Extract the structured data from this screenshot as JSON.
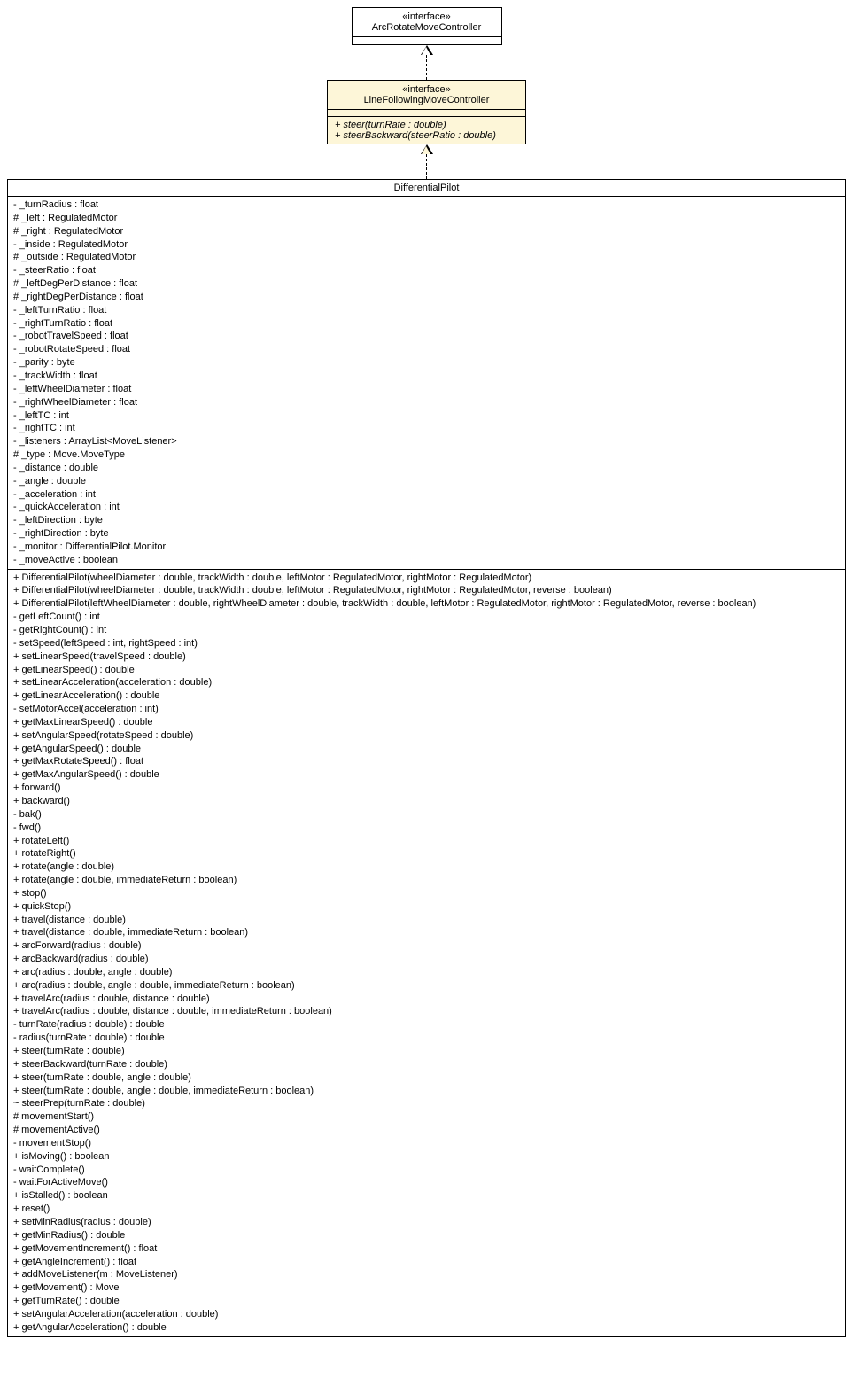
{
  "interface1": {
    "stereotype": "«interface»",
    "name": "ArcRotateMoveController"
  },
  "interface2": {
    "stereotype": "«interface»",
    "name": "LineFollowingMoveController",
    "ops": [
      "+ steer(turnRate : double)",
      "+ steerBackward(steerRatio : double)"
    ]
  },
  "class1": {
    "name": "DifferentialPilot",
    "attrs": [
      "- _turnRadius : float",
      "# _left : RegulatedMotor",
      "# _right : RegulatedMotor",
      "- _inside : RegulatedMotor",
      "# _outside : RegulatedMotor",
      "- _steerRatio : float",
      "# _leftDegPerDistance : float",
      "# _rightDegPerDistance : float",
      "- _leftTurnRatio : float",
      "- _rightTurnRatio : float",
      "- _robotTravelSpeed : float",
      "- _robotRotateSpeed : float",
      "- _parity : byte",
      "- _trackWidth : float",
      "- _leftWheelDiameter : float",
      "- _rightWheelDiameter : float",
      "- _leftTC : int",
      "- _rightTC : int",
      "- _listeners : ArrayList<MoveListener>",
      "# _type : Move.MoveType",
      "- _distance : double",
      "- _angle : double",
      "- _acceleration : int",
      "- _quickAcceleration : int",
      "- _leftDirection : byte",
      "- _rightDirection : byte",
      "- _monitor : DifferentialPilot.Monitor",
      "- _moveActive : boolean"
    ],
    "ops": [
      "+ DifferentialPilot(wheelDiameter : double, trackWidth : double, leftMotor : RegulatedMotor, rightMotor : RegulatedMotor)",
      "+ DifferentialPilot(wheelDiameter : double, trackWidth : double, leftMotor : RegulatedMotor, rightMotor : RegulatedMotor, reverse : boolean)",
      "+ DifferentialPilot(leftWheelDiameter : double, rightWheelDiameter : double, trackWidth : double, leftMotor : RegulatedMotor, rightMotor : RegulatedMotor, reverse : boolean)",
      "- getLeftCount() : int",
      "- getRightCount() : int",
      "- setSpeed(leftSpeed : int, rightSpeed : int)",
      "+ setLinearSpeed(travelSpeed : double)",
      "+ getLinearSpeed() : double",
      "+ setLinearAcceleration(acceleration : double)",
      "+ getLinearAcceleration() : double",
      "- setMotorAccel(acceleration : int)",
      "+ getMaxLinearSpeed() : double",
      "+ setAngularSpeed(rotateSpeed : double)",
      "+ getAngularSpeed() : double",
      "+ getMaxRotateSpeed() : float",
      "+ getMaxAngularSpeed() : double",
      "+ forward()",
      "+ backward()",
      "- bak()",
      "- fwd()",
      "+ rotateLeft()",
      "+ rotateRight()",
      "+ rotate(angle : double)",
      "+ rotate(angle : double, immediateReturn : boolean)",
      "+ stop()",
      "+ quickStop()",
      "+ travel(distance : double)",
      "+ travel(distance : double, immediateReturn : boolean)",
      "+ arcForward(radius : double)",
      "+ arcBackward(radius : double)",
      "+ arc(radius : double, angle : double)",
      "+ arc(radius : double, angle : double, immediateReturn : boolean)",
      "+ travelArc(radius : double, distance : double)",
      "+ travelArc(radius : double, distance : double, immediateReturn : boolean)",
      "- turnRate(radius : double) : double",
      "- radius(turnRate : double) : double",
      "+ steer(turnRate : double)",
      "+ steerBackward(turnRate : double)",
      "+ steer(turnRate : double, angle : double)",
      "+ steer(turnRate : double, angle : double, immediateReturn : boolean)",
      "~ steerPrep(turnRate : double)",
      "# movementStart()",
      "# movementActive()",
      "- movementStop()",
      "+ isMoving() : boolean",
      "- waitComplete()",
      "- waitForActiveMove()",
      "+ isStalled() : boolean",
      "+ reset()",
      "+ setMinRadius(radius : double)",
      "+ getMinRadius() : double",
      "+ getMovementIncrement() : float",
      "+ getAngleIncrement() : float",
      "+ addMoveListener(m : MoveListener)",
      "+ getMovement() : Move",
      "+ getTurnRate() : double",
      "+ setAngularAcceleration(acceleration : double)",
      "+ getAngularAcceleration() : double"
    ]
  },
  "chart_data": {
    "type": "uml-class-diagram",
    "nodes": [
      {
        "id": "ArcRotateMoveController",
        "kind": "interface"
      },
      {
        "id": "LineFollowingMoveController",
        "kind": "interface",
        "operations": [
          "steer(turnRate:double)",
          "steerBackward(steerRatio:double)"
        ]
      },
      {
        "id": "DifferentialPilot",
        "kind": "class"
      }
    ],
    "edges": [
      {
        "from": "LineFollowingMoveController",
        "to": "ArcRotateMoveController",
        "type": "realization"
      },
      {
        "from": "DifferentialPilot",
        "to": "LineFollowingMoveController",
        "type": "realization"
      }
    ]
  }
}
